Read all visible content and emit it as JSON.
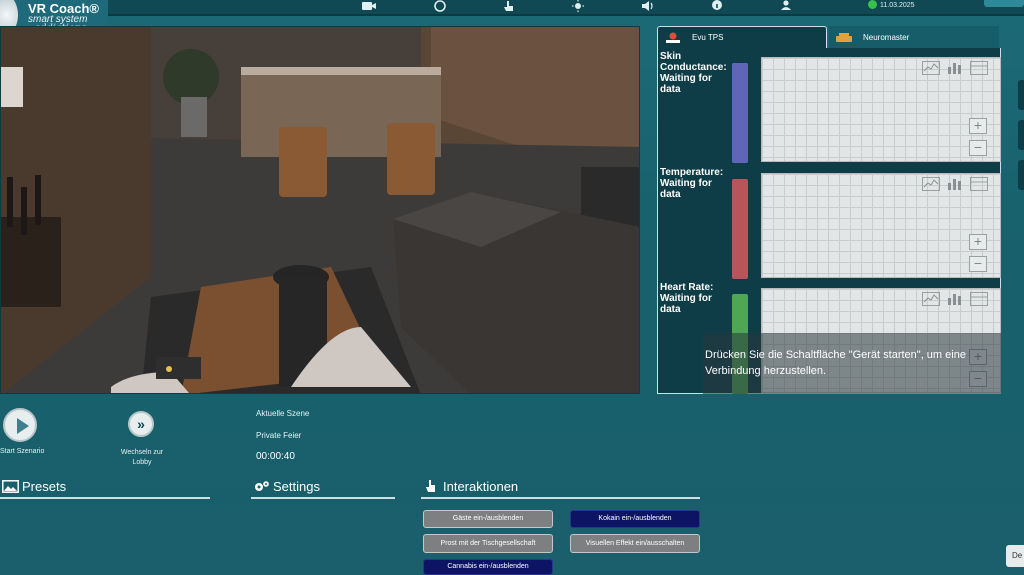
{
  "app": {
    "logo_line1": "VR Coach®",
    "logo_line2": "smart system",
    "logo_line3": "addictions"
  },
  "topbar": {
    "date": "11.03.2025",
    "icons": [
      "camera-icon",
      "sync-icon",
      "hand-pointer-icon",
      "brightness-icon",
      "volume-icon",
      "info-icon",
      "user-icon"
    ]
  },
  "sensors": {
    "tabs": [
      {
        "label": "Evu TPS",
        "icon": "tps-logo-icon",
        "active": true
      },
      {
        "label": "Neuromaster",
        "icon": "neuromaster-icon",
        "active": false
      }
    ],
    "items": [
      {
        "label": "Skin Conductance: Waiting for data",
        "color": "#5f66b8"
      },
      {
        "label": "Temperature: Waiting for data",
        "color": "#b8555b"
      },
      {
        "label": "Heart Rate: Waiting for data",
        "color": "#4fa655"
      }
    ],
    "overlay_message": "Drücken Sie die Schaltfläche \"Gerät starten\", um eine Verbindung herzustellen."
  },
  "controls": {
    "start_label": "Start Szenario",
    "lobby_label": "Wechseln zur Lobby",
    "current_scene_label": "Aktuelle Szene",
    "current_scene_name": "Private Feier",
    "timer": "00:00:40"
  },
  "sections": {
    "presets": "Presets",
    "settings": "Settings",
    "interactions": "Interaktionen"
  },
  "interactions": {
    "guests": "Gäste ein-/ausblenden",
    "cocaine": "Kokain ein-/ausblenden",
    "toast": "Prost mit der Tischgesellschaft",
    "visual_effect": "Visuellen Effekt ein/ausschalten",
    "cannabis": "Cannabis ein-/ausblenden"
  },
  "corner_button": "De"
}
